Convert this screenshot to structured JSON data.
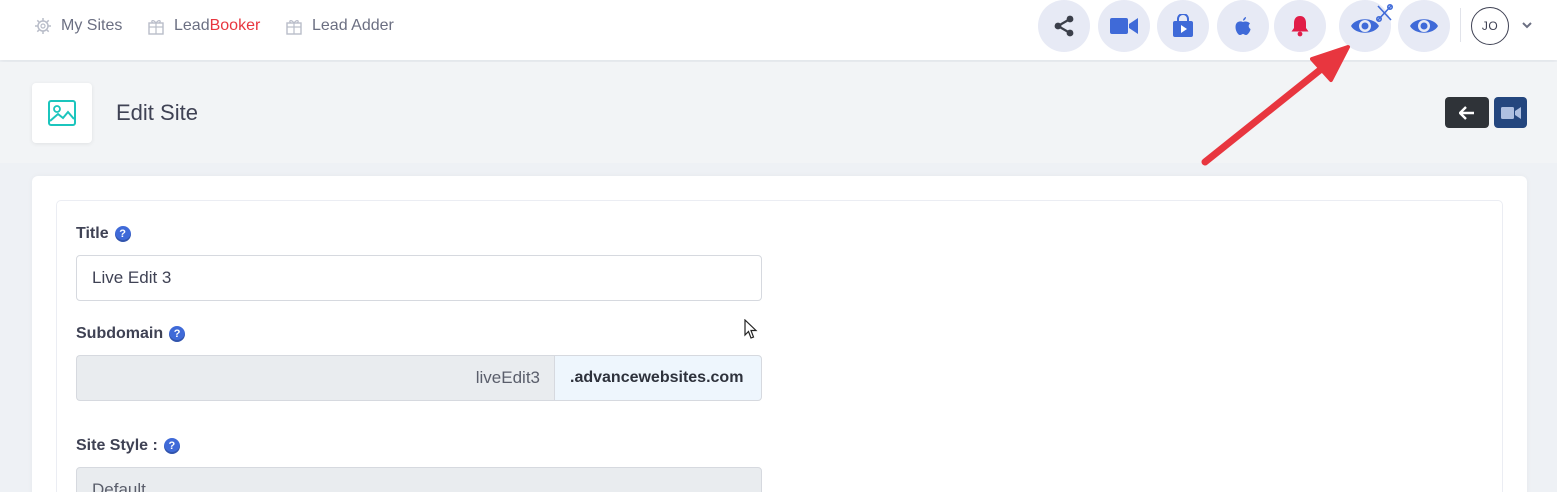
{
  "nav": {
    "links": [
      {
        "label": "My Sites"
      },
      {
        "label_a": "Lead",
        "label_b": "Booker"
      },
      {
        "label": "Lead Adder"
      }
    ],
    "actions": [
      "share-icon",
      "video-icon",
      "store-play-icon",
      "apple-icon",
      "bell-icon",
      "live-edit-eye-icon",
      "eye-icon"
    ],
    "user_initials": "JO"
  },
  "subheader": {
    "title": "Edit Site"
  },
  "form": {
    "title_label": "Title",
    "title_value": "Live Edit 3",
    "subdomain_label": "Subdomain",
    "subdomain_value": "liveEdit3",
    "subdomain_suffix": ".advancewebsites.com",
    "style_label": "Site Style :",
    "style_value": "Default",
    "help_glyph": "?"
  },
  "colors": {
    "accent_blue": "#3f6ad8",
    "brand_red": "#e8363f",
    "annotation_arrow": "#e8363f",
    "dark_button": "#2f3338",
    "video_button": "#24467e"
  }
}
